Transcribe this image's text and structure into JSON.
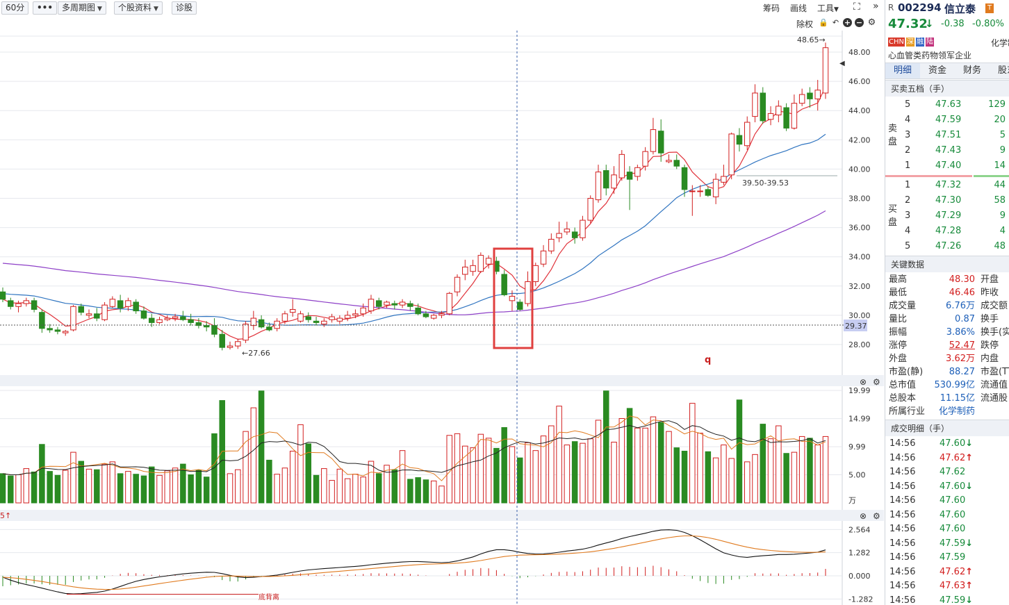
{
  "toolbar": {
    "period": "60分",
    "more": "•••",
    "multi_period": "多周期图",
    "stock_info": "个股资料",
    "diagnose": "诊股",
    "chips": "筹码",
    "draw": "画线",
    "tools": "工具",
    "exrights": "除权"
  },
  "chart": {
    "price_axis": [
      "48.00",
      "46.00",
      "44.00",
      "42.00",
      "40.00",
      "38.00",
      "36.00",
      "34.00",
      "32.00",
      "30.00",
      "28.00"
    ],
    "current_price_label": "29.37",
    "high_marker": "48.65→",
    "low_marker": "←27.66",
    "range_marker": "39.50-39.53",
    "q_mark": "q",
    "volume_axis": [
      "19.99",
      "14.99",
      "9.99",
      "5.00",
      "万"
    ],
    "macd_axis": [
      "2.564",
      "1.282",
      "0.000",
      "-1.282"
    ],
    "macd_note": "底背离",
    "left_mark": "5↑"
  },
  "panel": {
    "prefix": "R",
    "code": "002294",
    "name": "信立泰",
    "price": "47.32",
    "change": "-0.38",
    "change_pct": "-0.80%",
    "tags": [
      "CHN",
      "深",
      "融",
      "陆"
    ],
    "sector_short": "化学制",
    "description": "心血管类药物领军企业",
    "tabs": [
      "明细",
      "资金",
      "财务",
      "股东"
    ],
    "orderbook_title": "买卖五档（手）",
    "sell_label": "卖盘",
    "buy_label": "买盘",
    "asks": [
      {
        "level": "5",
        "price": "47.63",
        "vol": "129"
      },
      {
        "level": "4",
        "price": "47.59",
        "vol": "20"
      },
      {
        "level": "3",
        "price": "47.51",
        "vol": "5"
      },
      {
        "level": "2",
        "price": "47.43",
        "vol": "9"
      },
      {
        "level": "1",
        "price": "47.40",
        "vol": "14"
      }
    ],
    "bids": [
      {
        "level": "1",
        "price": "47.32",
        "vol": "44"
      },
      {
        "level": "2",
        "price": "47.30",
        "vol": "58"
      },
      {
        "level": "3",
        "price": "47.29",
        "vol": "9"
      },
      {
        "level": "4",
        "price": "47.28",
        "vol": "4"
      },
      {
        "level": "5",
        "price": "47.26",
        "vol": "48"
      }
    ],
    "key_title": "关键数据",
    "key_left": [
      {
        "k": "最高",
        "v": "48.30",
        "c": "red"
      },
      {
        "k": "最低",
        "v": "46.46",
        "c": "red"
      },
      {
        "k": "成交量",
        "v": "6.76万",
        "c": "blue"
      },
      {
        "k": "量比",
        "v": "0.87",
        "c": "blue"
      },
      {
        "k": "振幅",
        "v": "3.86%",
        "c": "blue"
      },
      {
        "k": "涨停",
        "v": "52.47",
        "c": "red"
      },
      {
        "k": "外盘",
        "v": "3.62万",
        "c": "red"
      },
      {
        "k": "市盈(静)",
        "v": "88.27",
        "c": "blue"
      },
      {
        "k": "总市值",
        "v": "530.99亿",
        "c": "blue"
      },
      {
        "k": "总股本",
        "v": "11.15亿",
        "c": "blue"
      },
      {
        "k": "所属行业",
        "v": "化学制药",
        "c": "blue"
      }
    ],
    "key_right": [
      "开盘",
      "昨收",
      "成交额",
      "换手",
      "换手(实)",
      "跌停",
      "内盘",
      "市盈(TTM)",
      "流通值",
      "流通股"
    ],
    "ticks_title": "成交明细（手）",
    "ticks": [
      {
        "t": "14:56",
        "p": "47.60",
        "d": "down"
      },
      {
        "t": "14:56",
        "p": "47.62",
        "d": "up"
      },
      {
        "t": "14:56",
        "p": "47.62",
        "d": ""
      },
      {
        "t": "14:56",
        "p": "47.60",
        "d": "down"
      },
      {
        "t": "14:56",
        "p": "47.60",
        "d": ""
      },
      {
        "t": "14:56",
        "p": "47.60",
        "d": ""
      },
      {
        "t": "14:56",
        "p": "47.60",
        "d": ""
      },
      {
        "t": "14:56",
        "p": "47.59",
        "d": "down"
      },
      {
        "t": "14:56",
        "p": "47.59",
        "d": ""
      },
      {
        "t": "14:56",
        "p": "47.62",
        "d": "up"
      },
      {
        "t": "14:56",
        "p": "47.63",
        "d": "up"
      },
      {
        "t": "14:56",
        "p": "47.59",
        "d": "down"
      }
    ]
  },
  "series": {
    "candles": [
      [
        31.6,
        31.9,
        30.9,
        31.1
      ],
      [
        31.0,
        31.2,
        30.4,
        30.6
      ],
      [
        30.6,
        31.0,
        30.2,
        30.8
      ],
      [
        30.8,
        31.2,
        30.6,
        31.0
      ],
      [
        31.0,
        31.2,
        30.2,
        30.4
      ],
      [
        30.2,
        30.4,
        28.8,
        29.1
      ],
      [
        29.1,
        29.4,
        28.8,
        29.0
      ],
      [
        29.0,
        29.2,
        28.7,
        28.9
      ],
      [
        28.8,
        29.0,
        28.6,
        28.9
      ],
      [
        29.0,
        30.7,
        28.9,
        30.6
      ],
      [
        30.6,
        30.8,
        30.0,
        30.2
      ],
      [
        30.0,
        30.4,
        29.8,
        30.1
      ],
      [
        30.1,
        30.5,
        29.6,
        29.8
      ],
      [
        29.7,
        30.9,
        29.6,
        30.7
      ],
      [
        30.6,
        31.3,
        30.5,
        31.1
      ],
      [
        31.0,
        31.4,
        30.2,
        30.5
      ],
      [
        30.6,
        31.2,
        30.3,
        31.0
      ],
      [
        30.9,
        31.1,
        30.1,
        30.3
      ],
      [
        30.3,
        30.6,
        29.7,
        29.8
      ],
      [
        29.8,
        30.1,
        29.2,
        29.5
      ],
      [
        29.5,
        29.9,
        29.4,
        29.7
      ],
      [
        29.7,
        30.0,
        29.6,
        29.8
      ],
      [
        29.8,
        30.1,
        29.6,
        29.9
      ],
      [
        29.9,
        30.3,
        29.6,
        29.7
      ],
      [
        29.7,
        30.1,
        29.3,
        29.5
      ],
      [
        29.5,
        29.8,
        29.1,
        29.3
      ],
      [
        29.3,
        29.6,
        28.9,
        29.2
      ],
      [
        29.3,
        29.8,
        28.5,
        28.7
      ],
      [
        28.7,
        29.0,
        27.6,
        27.8
      ],
      [
        27.8,
        28.2,
        27.66,
        27.9
      ],
      [
        27.9,
        28.4,
        27.7,
        28.2
      ],
      [
        28.3,
        29.6,
        28.1,
        29.4
      ],
      [
        29.3,
        30.3,
        29.0,
        29.8
      ],
      [
        29.7,
        30.0,
        29.1,
        29.2
      ],
      [
        29.2,
        29.5,
        28.9,
        29.0
      ],
      [
        29.1,
        29.8,
        28.9,
        29.6
      ],
      [
        29.6,
        30.3,
        29.4,
        30.1
      ],
      [
        30.2,
        31.1,
        29.9,
        30.4
      ],
      [
        29.6,
        30.3,
        29.5,
        30.1
      ],
      [
        29.9,
        30.2,
        29.5,
        29.7
      ],
      [
        29.6,
        29.9,
        29.3,
        29.5
      ],
      [
        29.4,
        29.8,
        29.2,
        29.6
      ],
      [
        29.7,
        30.1,
        29.5,
        29.9
      ],
      [
        29.6,
        30.0,
        29.4,
        29.8
      ],
      [
        29.8,
        30.3,
        29.6,
        30.0
      ],
      [
        30.0,
        30.4,
        29.8,
        30.1
      ],
      [
        30.1,
        30.8,
        29.9,
        30.5
      ],
      [
        30.3,
        31.4,
        30.1,
        31.1
      ],
      [
        31.0,
        31.2,
        30.4,
        30.6
      ],
      [
        30.7,
        31.0,
        30.5,
        30.9
      ],
      [
        30.8,
        31.0,
        30.4,
        30.7
      ],
      [
        30.7,
        31.1,
        30.5,
        30.9
      ],
      [
        30.8,
        31.0,
        30.3,
        30.6
      ],
      [
        30.5,
        30.8,
        30.0,
        30.1
      ],
      [
        30.1,
        30.3,
        29.8,
        29.9
      ],
      [
        29.8,
        30.1,
        29.7,
        30.0
      ],
      [
        30.0,
        30.3,
        29.8,
        30.1
      ],
      [
        30.1,
        31.6,
        30.0,
        31.5
      ],
      [
        31.6,
        32.8,
        31.3,
        32.6
      ],
      [
        32.8,
        33.8,
        32.4,
        33.3
      ],
      [
        33.0,
        33.8,
        32.7,
        33.4
      ],
      [
        33.0,
        34.3,
        32.9,
        34.1
      ],
      [
        33.5,
        34.1,
        33.2,
        33.9
      ],
      [
        33.7,
        34.0,
        32.8,
        33.0
      ],
      [
        32.8,
        33.1,
        31.3,
        31.4
      ],
      [
        31.0,
        31.7,
        30.3,
        31.3
      ],
      [
        30.9,
        31.1,
        30.3,
        30.4
      ],
      [
        30.8,
        33.0,
        30.6,
        32.3
      ],
      [
        32.3,
        33.6,
        32.0,
        33.4
      ],
      [
        33.5,
        34.8,
        33.3,
        34.4
      ],
      [
        34.4,
        35.6,
        34.2,
        35.2
      ],
      [
        35.3,
        36.4,
        35.0,
        35.6
      ],
      [
        35.7,
        36.4,
        35.5,
        35.9
      ],
      [
        35.7,
        36.0,
        34.9,
        35.3
      ],
      [
        35.3,
        36.8,
        35.1,
        36.5
      ],
      [
        36.5,
        38.2,
        36.3,
        38.0
      ],
      [
        37.9,
        40.3,
        37.7,
        39.8
      ],
      [
        39.9,
        40.3,
        38.2,
        38.7
      ],
      [
        38.7,
        40.2,
        38.3,
        39.6
      ],
      [
        39.4,
        41.3,
        39.2,
        41.0
      ],
      [
        39.8,
        40.2,
        37.2,
        39.3
      ],
      [
        39.5,
        40.3,
        39.2,
        40.1
      ],
      [
        40.2,
        41.5,
        39.9,
        41.2
      ],
      [
        41.2,
        43.5,
        41.0,
        42.7
      ],
      [
        42.6,
        43.4,
        40.5,
        41.1
      ],
      [
        40.5,
        41.0,
        40.4,
        40.6
      ],
      [
        40.6,
        41.0,
        40.0,
        40.2
      ],
      [
        40.1,
        40.3,
        38.1,
        38.6
      ],
      [
        38.5,
        38.9,
        36.8,
        38.5
      ],
      [
        38.5,
        38.9,
        38.1,
        38.5
      ],
      [
        38.6,
        38.8,
        38.1,
        38.2
      ],
      [
        38.1,
        39.7,
        37.6,
        39.3
      ],
      [
        39.1,
        40.3,
        38.9,
        39.5
      ],
      [
        39.6,
        42.5,
        39.3,
        42.4
      ],
      [
        42.3,
        42.8,
        41.2,
        41.7
      ],
      [
        41.6,
        43.6,
        41.3,
        43.2
      ],
      [
        43.6,
        45.8,
        43.2,
        45.2
      ],
      [
        45.2,
        45.6,
        43.1,
        43.3
      ],
      [
        43.4,
        44.3,
        43.0,
        43.8
      ],
      [
        43.7,
        44.7,
        43.2,
        44.3
      ],
      [
        44.2,
        44.5,
        42.6,
        42.8
      ],
      [
        42.8,
        45.1,
        42.7,
        44.5
      ],
      [
        44.5,
        45.5,
        44.3,
        45.1
      ],
      [
        45.2,
        45.6,
        44.2,
        44.8
      ],
      [
        44.8,
        46.1,
        44.0,
        45.4
      ],
      [
        45.2,
        48.65,
        44.8,
        48.3
      ]
    ],
    "volume": [
      5.2,
      4.8,
      5.0,
      6.1,
      5.5,
      10.4,
      5.6,
      4.9,
      5.8,
      9.0,
      7.4,
      6.0,
      5.9,
      6.9,
      7.3,
      5.2,
      5.6,
      5.1,
      4.8,
      6.4,
      4.9,
      5.7,
      6.2,
      6.9,
      5.0,
      5.8,
      4.6,
      12.3,
      18.2,
      5.2,
      5.9,
      12.7,
      16.9,
      19.9,
      7.6,
      5.1,
      6.2,
      9.2,
      13.9,
      10.5,
      4.9,
      6.1,
      4.0,
      6.0,
      4.3,
      5.1,
      4.6,
      7.4,
      5.2,
      6.7,
      5.9,
      9.3,
      4.2,
      4.5,
      4.1,
      3.9,
      3.0,
      12.0,
      12.3,
      10.1,
      9.8,
      12.2,
      11.5,
      9.7,
      13.4,
      10.0,
      8.0,
      10.7,
      9.3,
      11.9,
      13.7,
      17.2,
      10.3,
      10.9,
      10.6,
      11.4,
      14.7,
      19.9,
      10.8,
      15.0,
      16.8,
      13.3,
      13.3,
      15.3,
      14.3,
      12.7,
      9.8,
      9.2,
      17.7,
      12.4,
      9.1,
      8.0,
      10.3,
      7.9,
      18.3,
      7.3,
      8.6,
      14.0,
      11.4,
      13.7,
      8.8,
      9.0,
      11.8,
      11.5,
      10.3,
      11.8
    ],
    "macd_hist": [
      -0.64,
      -0.58,
      -0.53,
      -0.48,
      -0.47,
      -0.52,
      -0.55,
      -0.55,
      -0.55,
      -0.38,
      -0.29,
      -0.22,
      -0.22,
      -0.12,
      0.02,
      0.12,
      0.18,
      0.16,
      0.1,
      0.06,
      0.05,
      0.04,
      0.05,
      0.04,
      0.02,
      0.01,
      -0.01,
      -0.08,
      -0.26,
      -0.34,
      -0.35,
      -0.22,
      -0.08,
      -0.02,
      -0.02,
      0.03,
      0.09,
      0.13,
      0.15,
      0.11,
      0.07,
      0.06,
      0.07,
      0.07,
      0.08,
      0.08,
      0.11,
      0.16,
      0.15,
      0.15,
      0.14,
      0.14,
      0.12,
      0.07,
      0.02,
      0.0,
      0.0,
      0.11,
      0.25,
      0.37,
      0.41,
      0.48,
      0.46,
      0.35,
      0.12,
      -0.02,
      -0.14,
      -0.09,
      -0.02,
      0.08,
      0.18,
      0.24,
      0.26,
      0.23,
      0.28,
      0.38,
      0.51,
      0.49,
      0.51,
      0.59,
      0.55,
      0.53,
      0.55,
      0.62,
      0.53,
      0.4,
      0.28,
      0.04,
      -0.18,
      -0.32,
      -0.44,
      -0.5,
      -0.48,
      -0.25,
      -0.2,
      -0.06,
      0.16,
      0.14,
      0.14,
      0.15,
      0.06,
      0.11,
      0.16,
      0.17,
      0.2,
      0.43
    ]
  }
}
